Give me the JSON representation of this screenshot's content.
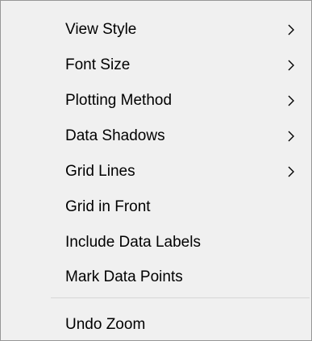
{
  "menu": {
    "items": [
      {
        "label": "View Style",
        "has_submenu": true
      },
      {
        "label": "Font Size",
        "has_submenu": true
      },
      {
        "label": "Plotting Method",
        "has_submenu": true
      },
      {
        "label": "Data Shadows",
        "has_submenu": true
      },
      {
        "label": "Grid Lines",
        "has_submenu": true
      },
      {
        "label": "Grid in Front",
        "has_submenu": false
      },
      {
        "label": "Include Data Labels",
        "has_submenu": false
      },
      {
        "label": "Mark Data Points",
        "has_submenu": false
      }
    ],
    "footer_items": [
      {
        "label": "Undo Zoom",
        "has_submenu": false
      }
    ],
    "submenu_icon": "chevron-right-icon",
    "colors": {
      "background": "#f0f0f0",
      "border": "#979797",
      "separator": "#d7d7d7",
      "text": "#000000"
    }
  }
}
